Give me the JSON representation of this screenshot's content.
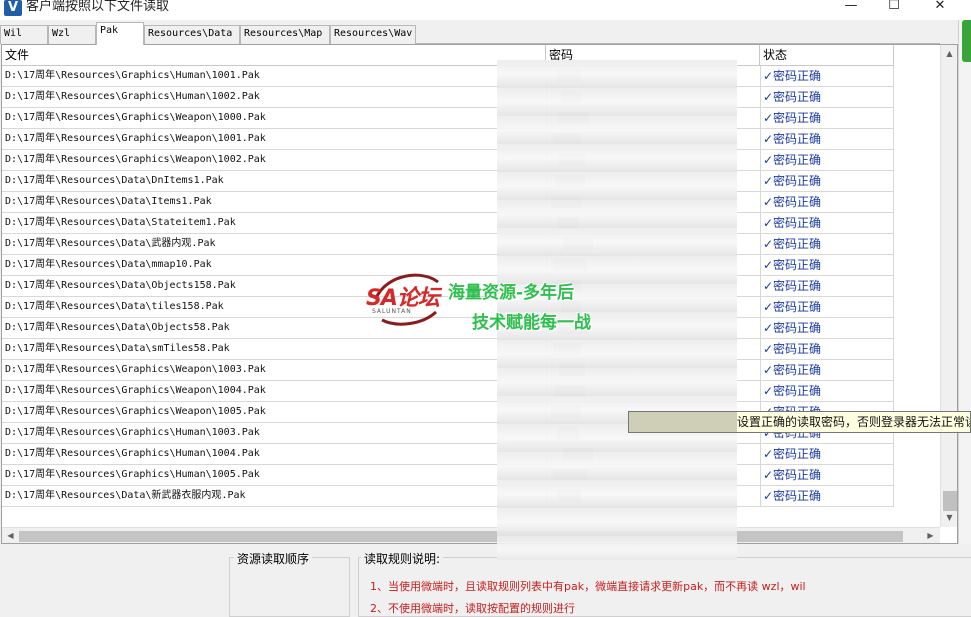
{
  "window": {
    "title": "客户端按照以下文件读取",
    "minimize": "—",
    "maximize": "☐",
    "close": "✕"
  },
  "tabs": [
    {
      "label": "Wil",
      "active": false
    },
    {
      "label": "Wzl",
      "active": false
    },
    {
      "label": "Pak",
      "active": true
    },
    {
      "label": "Resources\\Data",
      "active": false
    },
    {
      "label": "Resources\\Map",
      "active": false
    },
    {
      "label": "Resources\\Wav",
      "active": false
    }
  ],
  "list": {
    "columns": {
      "file": "文件",
      "code": "密码",
      "status": "状态"
    },
    "rows": [
      {
        "file": "D:\\17周年\\Resources\\Graphics\\Human\\1001.Pak",
        "status": "✓密码正确"
      },
      {
        "file": "D:\\17周年\\Resources\\Graphics\\Human\\1002.Pak",
        "status": "✓密码正确"
      },
      {
        "file": "D:\\17周年\\Resources\\Graphics\\Weapon\\1000.Pak",
        "status": "✓密码正确"
      },
      {
        "file": "D:\\17周年\\Resources\\Graphics\\Weapon\\1001.Pak",
        "status": "✓密码正确"
      },
      {
        "file": "D:\\17周年\\Resources\\Graphics\\Weapon\\1002.Pak",
        "status": "✓密码正确"
      },
      {
        "file": "D:\\17周年\\Resources\\Data\\DnItems1.Pak",
        "status": "✓密码正确"
      },
      {
        "file": "D:\\17周年\\Resources\\Data\\Items1.Pak",
        "status": "✓密码正确"
      },
      {
        "file": "D:\\17周年\\Resources\\Data\\Stateitem1.Pak",
        "status": "✓密码正确"
      },
      {
        "file": "D:\\17周年\\Resources\\Data\\武器内观.Pak",
        "status": "✓密码正确"
      },
      {
        "file": "D:\\17周年\\Resources\\Data\\mmap10.Pak",
        "status": "✓密码正确"
      },
      {
        "file": "D:\\17周年\\Resources\\Data\\Objects158.Pak",
        "status": "✓密码正确"
      },
      {
        "file": "D:\\17周年\\Resources\\Data\\tiles158.Pak",
        "status": "✓密码正确"
      },
      {
        "file": "D:\\17周年\\Resources\\Data\\Objects58.Pak",
        "status": "✓密码正确"
      },
      {
        "file": "D:\\17周年\\Resources\\Data\\smTiles58.Pak",
        "status": "✓密码正确"
      },
      {
        "file": "D:\\17周年\\Resources\\Graphics\\Weapon\\1003.Pak",
        "status": "✓密码正确"
      },
      {
        "file": "D:\\17周年\\Resources\\Graphics\\Weapon\\1004.Pak",
        "status": "✓密码正确"
      },
      {
        "file": "D:\\17周年\\Resources\\Graphics\\Weapon\\1005.Pak",
        "status": "✓密码正确"
      },
      {
        "file": "D:\\17周年\\Resources\\Graphics\\Human\\1003.Pak",
        "status": "✓密码正确"
      },
      {
        "file": "D:\\17周年\\Resources\\Graphics\\Human\\1004.Pak",
        "status": "✓密码正确"
      },
      {
        "file": "D:\\17周年\\Resources\\Graphics\\Human\\1005.Pak",
        "status": "✓密码正确"
      },
      {
        "file": "D:\\17周年\\Resources\\Data\\新武器衣服内观.Pak",
        "status": "✓密码正确"
      }
    ]
  },
  "tooltip": {
    "text": "设置正确的读取密码，否则登录器无法正常读"
  },
  "watermark": {
    "logo": "SA论坛",
    "logo_sub": "SALUNTAN",
    "line1": "海量资源-多年后",
    "line2": "技术赋能每一战"
  },
  "bottom": {
    "order_label": "资源读取顺序",
    "rules_label": "读取规则说明:",
    "rule1": "1、当使用微端时，且读取规则列表中有pak，微端直接请求更新pak，而不再读 wzl，wil",
    "rule2": "2、不使用微端时，读取按配置的规则进行"
  },
  "colors": {
    "status_text": "#1a3aa0",
    "rule_text": "#c81e1e",
    "watermark_green": "#2fbf4f",
    "watermark_red": "#d62828"
  }
}
